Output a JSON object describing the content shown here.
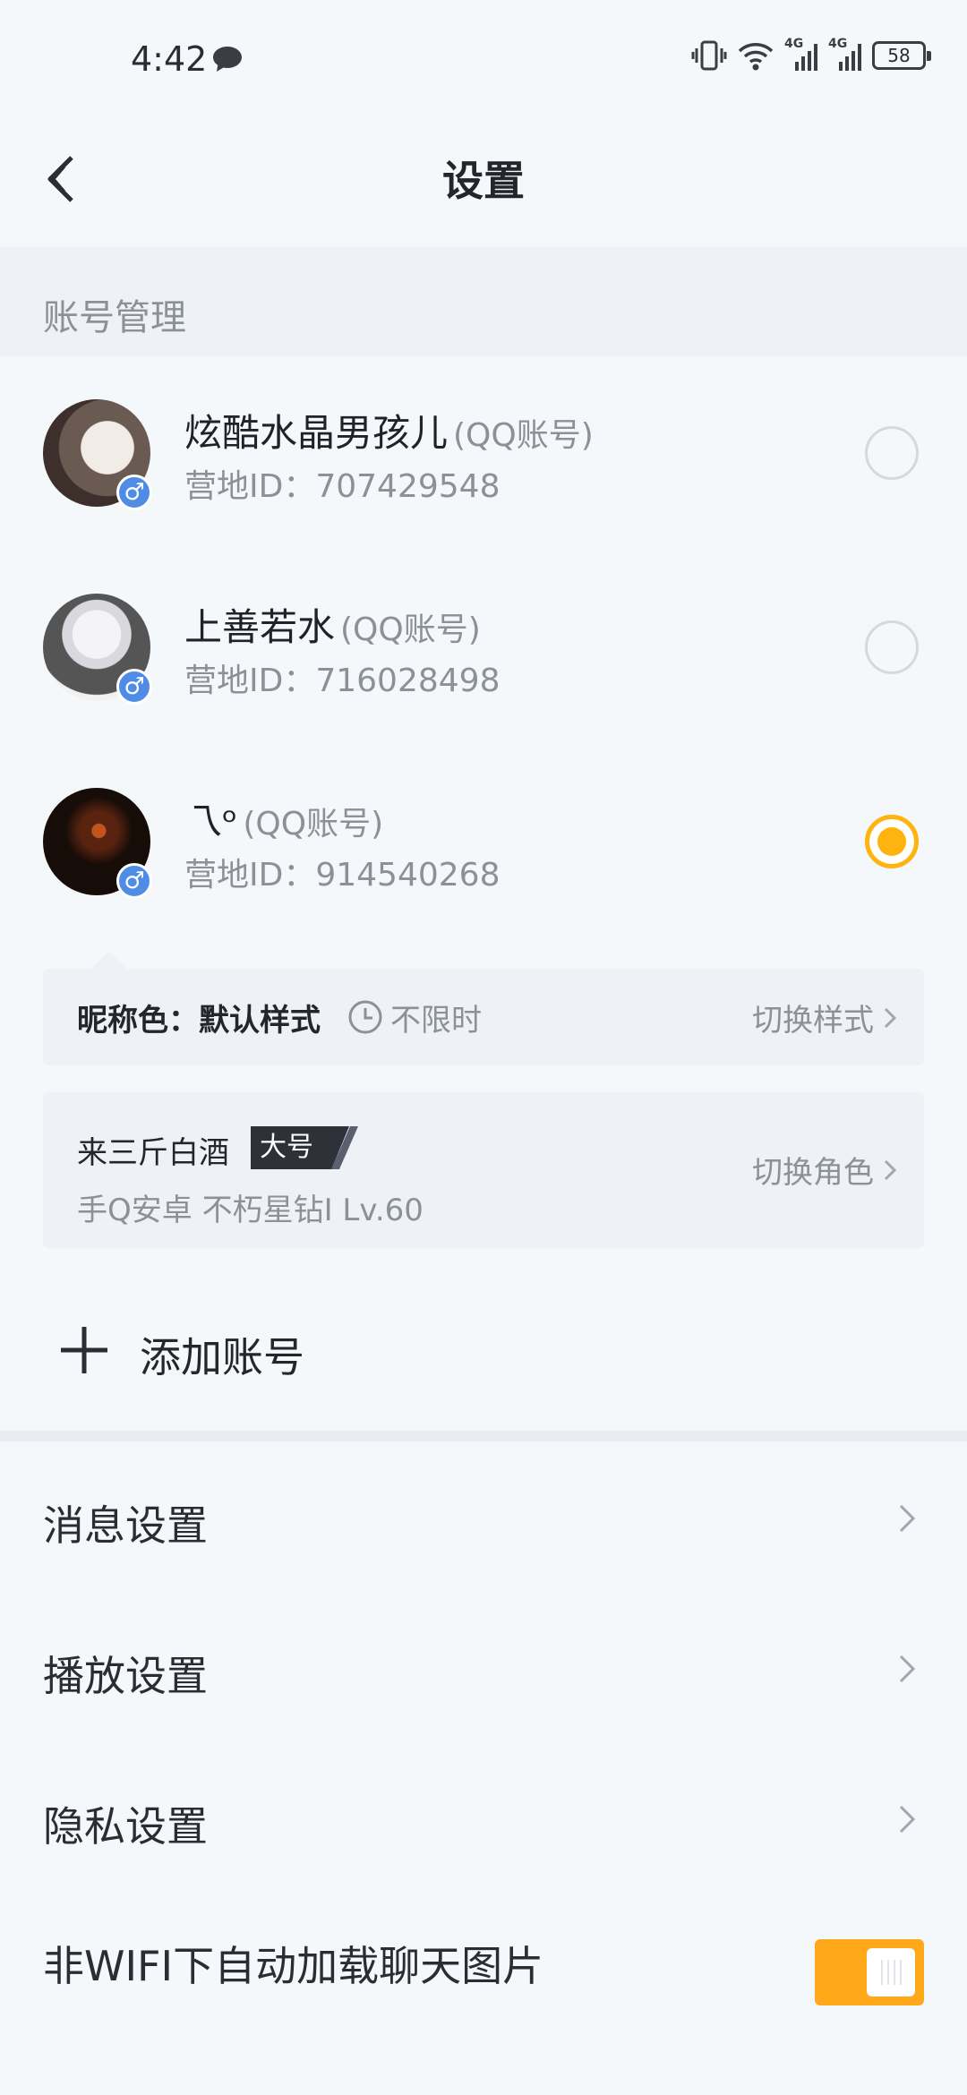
{
  "status_bar": {
    "time": "4:42",
    "network_1": "4G",
    "network_2": "4G",
    "battery": "58"
  },
  "header": {
    "title": "设置"
  },
  "account_section": {
    "title": "账号管理",
    "accounts": [
      {
        "name": "炫酷水晶男孩儿",
        "type": "(QQ账号)",
        "id_label": "营地ID：707429548",
        "gender": "♂",
        "selected": false
      },
      {
        "name": "上善若水",
        "type": "(QQ账号)",
        "id_label": "营地ID：716028498",
        "gender": "♂",
        "selected": false
      },
      {
        "name": "乁ᵒ",
        "type": "(QQ账号)",
        "id_label": "营地ID：914540268",
        "gender": "♂",
        "selected": true
      }
    ],
    "nickname_color": {
      "label": "昵称色：默认样式",
      "limit": "不限时",
      "action": "切换样式"
    },
    "role": {
      "name": "来三斤白酒",
      "badge": "大号",
      "info": "手Q安卓  不朽星钻I  Lv.60",
      "action": "切换角色"
    },
    "add_account": "添加账号"
  },
  "settings": [
    {
      "label": "消息设置"
    },
    {
      "label": "播放设置"
    },
    {
      "label": "隐私设置"
    },
    {
      "label": "非WIFI下自动加载聊天图片",
      "toggle_on": true
    }
  ],
  "colors": {
    "accent": "#ffb30f",
    "toggle": "#ffa81a",
    "gender_badge": "#4e8ce6"
  }
}
